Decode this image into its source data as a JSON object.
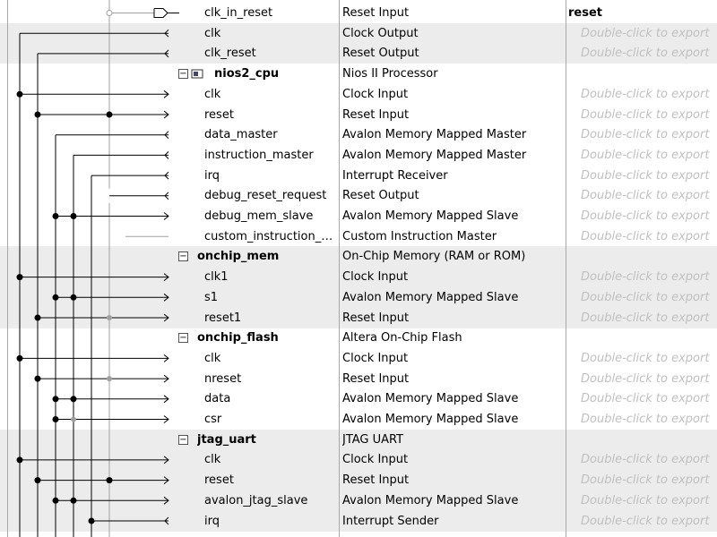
{
  "rows": [
    {
      "type": "port",
      "name": "clk_in_reset",
      "desc": "Reset Input",
      "export": "reset",
      "exported": true,
      "shaded": false
    },
    {
      "type": "port",
      "name": "clk",
      "desc": "Clock Output",
      "export": "Double-click to export",
      "shaded": true
    },
    {
      "type": "port",
      "name": "clk_reset",
      "desc": "Reset Output",
      "export": "Double-click to export",
      "shaded": true
    },
    {
      "type": "component",
      "name": "nios2_cpu",
      "desc": "Nios II Processor",
      "export": "",
      "icon": "cpu-chip-icon",
      "shaded": false
    },
    {
      "type": "port",
      "name": "clk",
      "desc": "Clock Input",
      "export": "Double-click to export",
      "shaded": false
    },
    {
      "type": "port",
      "name": "reset",
      "desc": "Reset Input",
      "export": "Double-click to export",
      "shaded": false
    },
    {
      "type": "port",
      "name": "data_master",
      "desc": "Avalon Memory Mapped Master",
      "export": "Double-click to export",
      "shaded": false
    },
    {
      "type": "port",
      "name": "instruction_master",
      "desc": "Avalon Memory Mapped Master",
      "export": "Double-click to export",
      "shaded": false
    },
    {
      "type": "port",
      "name": "irq",
      "desc": "Interrupt Receiver",
      "export": "Double-click to export",
      "shaded": false
    },
    {
      "type": "port",
      "name": "debug_reset_request",
      "desc": "Reset Output",
      "export": "Double-click to export",
      "shaded": false
    },
    {
      "type": "port",
      "name": "debug_mem_slave",
      "desc": "Avalon Memory Mapped Slave",
      "export": "Double-click to export",
      "shaded": false
    },
    {
      "type": "port",
      "name": "custom_instruction_m...",
      "desc": "Custom Instruction Master",
      "export": "Double-click to export",
      "shaded": false
    },
    {
      "type": "component",
      "name": "onchip_mem",
      "desc": "On-Chip Memory (RAM or ROM)",
      "export": "",
      "shaded": true
    },
    {
      "type": "port",
      "name": "clk1",
      "desc": "Clock Input",
      "export": "Double-click to export",
      "shaded": true
    },
    {
      "type": "port",
      "name": "s1",
      "desc": "Avalon Memory Mapped Slave",
      "export": "Double-click to export",
      "shaded": true
    },
    {
      "type": "port",
      "name": "reset1",
      "desc": "Reset Input",
      "export": "Double-click to export",
      "shaded": true
    },
    {
      "type": "component",
      "name": "onchip_flash",
      "desc": "Altera On-Chip Flash",
      "export": "",
      "shaded": false
    },
    {
      "type": "port",
      "name": "clk",
      "desc": "Clock Input",
      "export": "Double-click to export",
      "shaded": false
    },
    {
      "type": "port",
      "name": "nreset",
      "desc": "Reset Input",
      "export": "Double-click to export",
      "shaded": false
    },
    {
      "type": "port",
      "name": "data",
      "desc": "Avalon Memory Mapped Slave",
      "export": "Double-click to export",
      "shaded": false
    },
    {
      "type": "port",
      "name": "csr",
      "desc": "Avalon Memory Mapped Slave",
      "export": "Double-click to export",
      "shaded": false
    },
    {
      "type": "component",
      "name": "jtag_uart",
      "desc": "JTAG UART",
      "export": "",
      "shaded": true
    },
    {
      "type": "port",
      "name": "clk",
      "desc": "Clock Input",
      "export": "Double-click to export",
      "shaded": true
    },
    {
      "type": "port",
      "name": "reset",
      "desc": "Reset Input",
      "export": "Double-click to export",
      "shaded": true
    },
    {
      "type": "port",
      "name": "avalon_jtag_slave",
      "desc": "Avalon Memory Mapped Slave",
      "export": "Double-click to export",
      "shaded": true
    },
    {
      "type": "port",
      "name": "irq",
      "desc": "Interrupt Sender",
      "export": "Double-click to export",
      "shaded": true
    }
  ],
  "colors": {
    "wire": "#000000",
    "faint_wire": "#a0a0a0",
    "row_shade": "#ececec",
    "export_hint": "#c0c0c0"
  }
}
